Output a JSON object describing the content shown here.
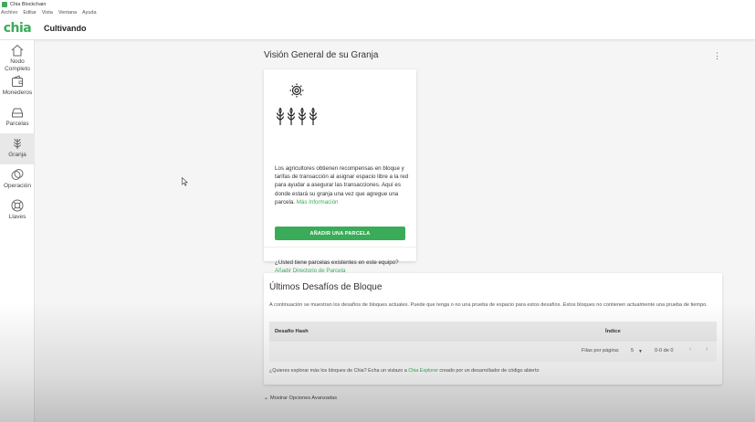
{
  "window": {
    "title": "Chia Blockchain"
  },
  "menu": [
    "Archivo",
    "Editar",
    "Vista",
    "Ventana",
    "Ayuda"
  ],
  "appbar": {
    "logo": "chia",
    "title": "Cultivando"
  },
  "sidebar": {
    "items": [
      {
        "label": "Nodo Completo",
        "icon": "home-icon",
        "active": false
      },
      {
        "label": "Monederos",
        "icon": "wallet-icon",
        "active": false
      },
      {
        "label": "Parcelas",
        "icon": "hdd-icon",
        "active": false
      },
      {
        "label": "Granja",
        "icon": "farm-icon",
        "active": true
      },
      {
        "label": "Operación",
        "icon": "pool-icon",
        "active": false
      },
      {
        "label": "Llaves",
        "icon": "lifebuoy-icon",
        "active": false
      }
    ]
  },
  "main": {
    "title": "Visión General de su Granja",
    "menu_icon": "⋮",
    "intro_card": {
      "description": "Los agricultores obtienen recompensas en bloque y tarifas de transacción al asignar espacio libre a la red para ayudar a asegurar las transacciones. Aquí es donde estará su granja una vez que agregue una parcela.",
      "more_link": "Más Información",
      "add_button": "AÑADIR UNA PARCELA",
      "existing_text": "¿Usted tiene parcelas existentes en este equipo?",
      "existing_link": "Añadir Directorio de Parcela"
    },
    "challenges_card": {
      "title": "Últimos Desafíos de Bloque",
      "description": "A continuación se muestran los desafíos de bloques actuales. Puede que tenga o no una prueba de espacio para estos desafíos. Estos bloques no contienen actualmente una prueba de tiempo.",
      "columns": [
        "Desafío Hash",
        "Índice"
      ],
      "rows_per_page_label": "Filas por página:",
      "rows_per_page_value": "5",
      "range": "0-0 de 0",
      "footer_text": "¿Quieres explorar más los bloques de Chia? Echa un vistazo a",
      "footer_link": "Chia Explorer",
      "footer_text_after": "creado por un desarrollador de código abierto"
    },
    "advanced_toggle": "Mostrar Opciones Avanzadas"
  },
  "colors": {
    "accent": "#3aac59"
  }
}
